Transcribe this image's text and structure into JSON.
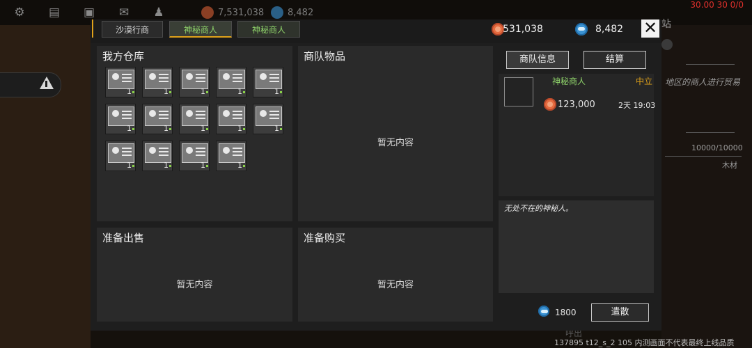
{
  "background": {
    "top_bar": {
      "coins": "7,531,038",
      "gems": "8,482",
      "debug_fps": "30.00 30 0/0"
    },
    "side_text": {
      "station_char": "站",
      "trade_desc": "地区的商人进行贸易",
      "capacity": "10000/10000",
      "material": "木材",
      "footer_hint": "呼出",
      "build_watermark": "137895 t12_s_2 105  内测画面不代表最终上线品质"
    }
  },
  "dialog": {
    "tabs": [
      {
        "label": "沙漠行商",
        "state": "inactive"
      },
      {
        "label": "神秘商人",
        "state": "active"
      },
      {
        "label": "神秘商人",
        "state": "inactive"
      }
    ],
    "currency": {
      "coins": "531,038",
      "gems": "8,482"
    },
    "panels": {
      "warehouse": {
        "title": "我方仓库",
        "slots": [
          {
            "qty": "1"
          },
          {
            "qty": "1"
          },
          {
            "qty": "1"
          },
          {
            "qty": "1"
          },
          {
            "qty": "1"
          },
          {
            "qty": "1"
          },
          {
            "qty": "1"
          },
          {
            "qty": "1"
          },
          {
            "qty": "1"
          },
          {
            "qty": "1"
          },
          {
            "qty": "1"
          },
          {
            "qty": "1"
          },
          {
            "qty": "1"
          },
          {
            "qty": "1"
          }
        ]
      },
      "caravan": {
        "title": "商队物品",
        "empty": "暂无内容"
      },
      "sell": {
        "title": "准备出售",
        "empty": "暂无内容"
      },
      "buy": {
        "title": "准备购买",
        "empty": "暂无内容"
      }
    },
    "right": {
      "info_button": "商队信息",
      "settle_button": "结算",
      "merchant_name": "神秘商人",
      "stance": "中立",
      "merchant_coins": "123,000",
      "time_left": "2天 19:03",
      "description": "无处不在的神秘人。",
      "dismiss_cost": "1800",
      "dismiss_button": "遣散"
    }
  },
  "colors": {
    "accent_gold": "#e0a21a",
    "active_green": "#8fd36a",
    "coin": "#e56b3f",
    "gem": "#3b93d3"
  }
}
